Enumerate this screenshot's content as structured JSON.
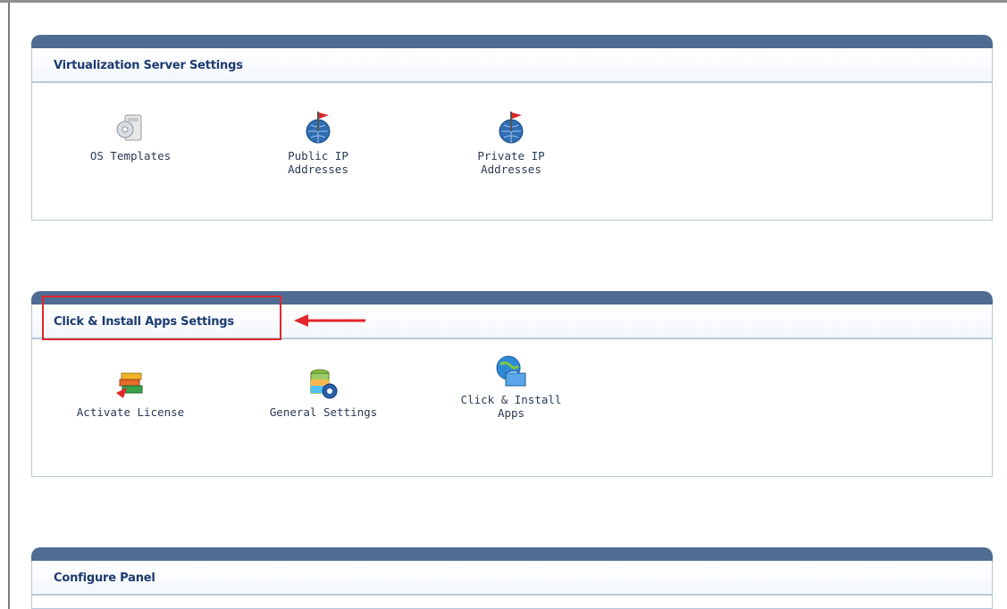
{
  "sections": [
    {
      "title": "Virtualization Server Settings",
      "items": [
        {
          "label_lines": [
            "OS Templates"
          ],
          "icon": "os-templates-icon"
        },
        {
          "label_lines": [
            "Public IP",
            "Addresses"
          ],
          "icon": "globe-flag-icon"
        },
        {
          "label_lines": [
            "Private IP",
            "Addresses"
          ],
          "icon": "globe-flag-icon"
        }
      ]
    },
    {
      "title": "Click & Install Apps Settings",
      "items": [
        {
          "label_lines": [
            "Activate License"
          ],
          "icon": "license-icon"
        },
        {
          "label_lines": [
            "General Settings"
          ],
          "icon": "database-gear-icon"
        },
        {
          "label_lines": [
            "Click & Install",
            "Apps"
          ],
          "icon": "globe-folder-icon"
        }
      ]
    },
    {
      "title": "Configure Panel",
      "items": []
    }
  ],
  "colors": {
    "panel_bar": "#4f6c93",
    "title_text": "#1c3a70",
    "highlight": "#e3262a"
  }
}
